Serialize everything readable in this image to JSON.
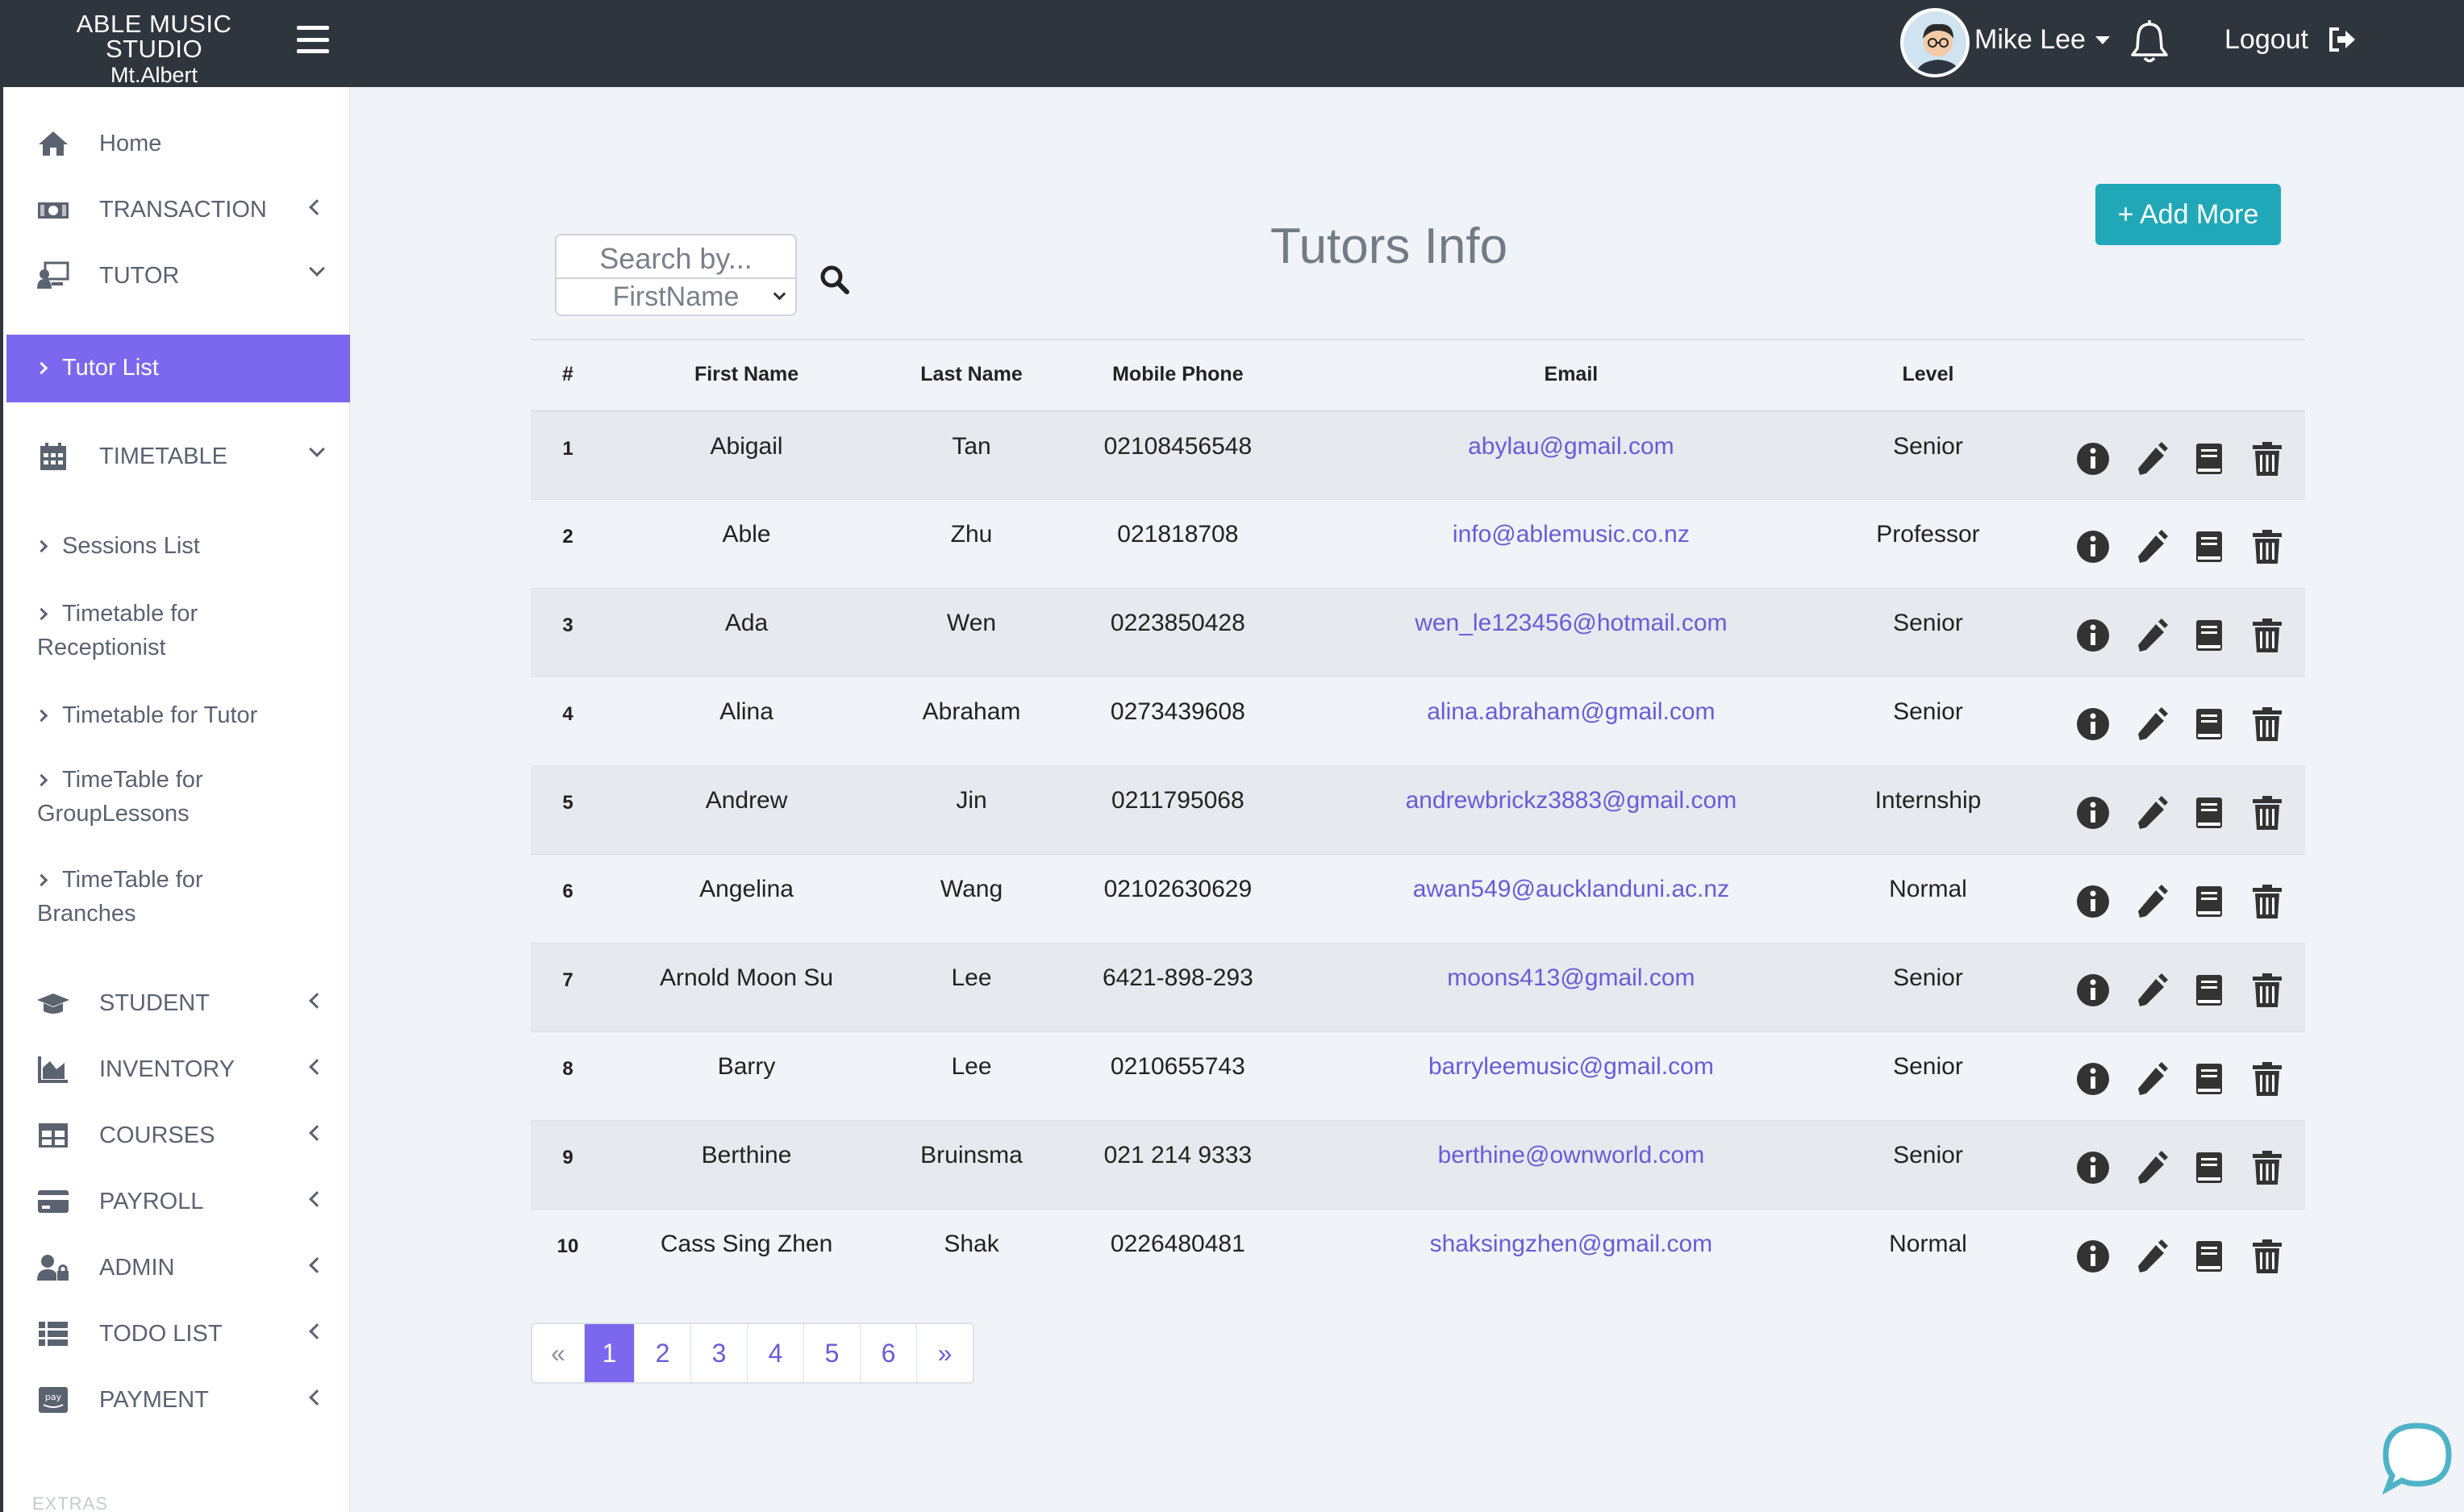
{
  "brand": {
    "line1": "ABLE MUSIC STUDIO",
    "line2": "Mt.Albert"
  },
  "header": {
    "user_name": "Mike Lee",
    "logout_label": "Logout"
  },
  "sidebar": {
    "items": [
      {
        "label": "Home",
        "icon": "home-icon"
      },
      {
        "label": "TRANSACTION",
        "icon": "money-icon"
      },
      {
        "label": "TUTOR",
        "icon": "tutor-icon"
      },
      {
        "label": "TIMETABLE",
        "icon": "calendar-icon"
      },
      {
        "label": "STUDENT",
        "icon": "graduation-cap-icon"
      },
      {
        "label": "INVENTORY",
        "icon": "chart-area-icon"
      },
      {
        "label": "COURSES",
        "icon": "table-icon"
      },
      {
        "label": "PAYROLL",
        "icon": "credit-card-icon"
      },
      {
        "label": "ADMIN",
        "icon": "user-lock-icon"
      },
      {
        "label": "TODO LIST",
        "icon": "list-icon"
      },
      {
        "label": "PAYMENT",
        "icon": "pay-icon"
      }
    ],
    "tutor_sub": [
      "Tutor List"
    ],
    "timetable_sub": [
      "Sessions List",
      "Timetable for Receptionist",
      "Timetable for Tutor",
      "TimeTable for GroupLessons",
      "TimeTable for Branches"
    ],
    "extras_label": "EXTRAS"
  },
  "main": {
    "title": "Tutors Info",
    "search_placeholder": "Search by...",
    "search_field": "FirstName",
    "add_button": "+ Add More",
    "columns": [
      "#",
      "First Name",
      "Last Name",
      "Mobile Phone",
      "Email",
      "Level"
    ],
    "rows": [
      {
        "num": "1",
        "first": "Abigail",
        "last": "Tan",
        "phone": "02108456548",
        "email": "abylau@gmail.com",
        "level": "Senior"
      },
      {
        "num": "2",
        "first": "Able",
        "last": "Zhu",
        "phone": "021818708",
        "email": "info@ablemusic.co.nz",
        "level": "Professor"
      },
      {
        "num": "3",
        "first": "Ada",
        "last": "Wen",
        "phone": "0223850428",
        "email": "wen_le123456@hotmail.com",
        "level": "Senior"
      },
      {
        "num": "4",
        "first": "Alina",
        "last": "Abraham",
        "phone": "0273439608",
        "email": "alina.abraham@gmail.com",
        "level": "Senior"
      },
      {
        "num": "5",
        "first": "Andrew",
        "last": "Jin",
        "phone": "0211795068",
        "email": "andrewbrickz3883@gmail.com",
        "level": "Internship"
      },
      {
        "num": "6",
        "first": "Angelina",
        "last": "Wang",
        "phone": "02102630629",
        "email": "awan549@aucklanduni.ac.nz",
        "level": "Normal"
      },
      {
        "num": "7",
        "first": "Arnold Moon Su",
        "last": "Lee",
        "phone": "6421-898-293",
        "email": "moons413@gmail.com",
        "level": "Senior"
      },
      {
        "num": "8",
        "first": "Barry",
        "last": "Lee",
        "phone": "0210655743",
        "email": "barryleemusic@gmail.com",
        "level": "Senior"
      },
      {
        "num": "9",
        "first": "Berthine",
        "last": "Bruinsma",
        "phone": "021 214 9333",
        "email": "berthine@ownworld.com",
        "level": "Senior"
      },
      {
        "num": "10",
        "first": "Cass Sing Zhen",
        "last": "Shak",
        "phone": "0226480481",
        "email": "shaksingzhen@gmail.com",
        "level": "Normal"
      }
    ],
    "row_actions": [
      "info-icon",
      "edit-icon",
      "book-icon",
      "trash-icon"
    ],
    "pagination": [
      "«",
      "1",
      "2",
      "3",
      "4",
      "5",
      "6",
      "»"
    ],
    "current_page": "1"
  },
  "colors": {
    "topbar": "#2f353d",
    "accent": "#7b68ee",
    "teal_button": "#20a8b8",
    "link": "#6a5bd6"
  }
}
